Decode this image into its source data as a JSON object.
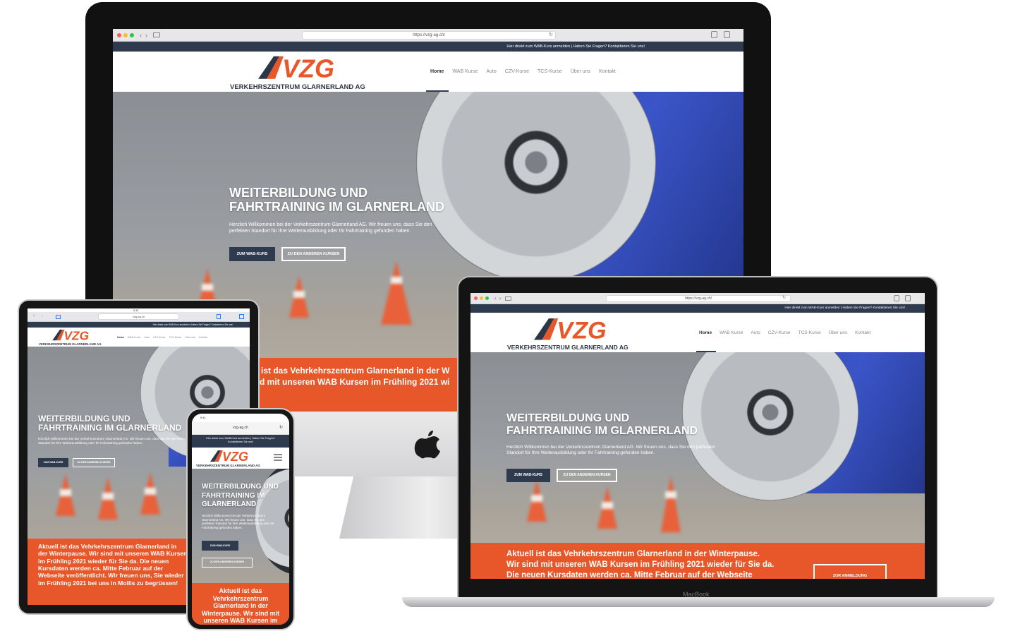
{
  "site": {
    "url": "https://vzg-ag.ch/",
    "url_short": "vzg-ag.ch",
    "topbar": "Hier direkt zum WAB-Kurs anmelden | Haben Sie Fragen? Kontaktieren Sie uns!",
    "logo_mark": "VZG",
    "logo_tagline": "VERKEHRSZENTRUM GLARNERLAND AG",
    "nav": [
      "Home",
      "WAB Kurse",
      "Auto",
      "CZV-Kurse",
      "TCS-Kurse",
      "Über uns",
      "Kontakt"
    ],
    "hero_title_line1": "WEITERBILDUNG UND",
    "hero_title_line2": "FAHRTRAINING IM GLARNERLAND",
    "hero_text": "Herzlich Willkommen bei der Verkehrszentrum Glarnerland AG. Wir freuen uns, dass Sie den perfekten Standort für Ihre Weiterausbildung oder Ihr Fahrtraining gefunden haben.",
    "btn_primary": "ZUM WAB-KURS",
    "btn_secondary": "ZU DEN ANDEREN KURSEN",
    "btn_register": "ZUR ANMELDUNG",
    "notice": "Aktuell ist das Vehrkehrszentrum Glarnerland in der Winterpause. Wir sind mit unseren WAB Kursen im Frühling 2021 wieder für Sie da. Die neuen Kursdaten werden ca. Mitte Februar auf der Webseite veröffentlicht. Wir freuen uns, Sie wieder im Frühling 2021 bei uns in Mollis zu begrüssen!",
    "imac_notice_line1": "ist das Vehrkehrszentrum Glarnerland in der W",
    "imac_notice_line2": "d mit unseren WAB Kursen im Frühling 2021 wi",
    "laptop_notice_line1": "Aktuell ist das Vehrkehrszentrum Glarnerland in der Winterpause.",
    "laptop_notice_line2": "Wir sind mit unseren WAB Kursen im Frühling 2021 wieder für Sie da.",
    "laptop_notice_line3": "Die neuen Kursdaten werden ca. Mitte Februar auf der Webseite",
    "phone_notice": "Aktuell ist das Vehrkehrszentrum Glarnerland in der Winterpause. Wir sind mit unseren WAB Kursen im",
    "phone_title": "WEITERBILDUNG UND FAHRTRAINING IM GLARNERLAND",
    "phone_topbar": "Hier direkt zum WAB-Kurs anmelden | Haben Sie Fragen? Kontaktieren Sie uns!",
    "laptop_label": "MacBook",
    "status_time": "9:41"
  },
  "colors": {
    "navy": "#2e3b4e",
    "orange": "#e8572a",
    "logo_orange": "#e8572a",
    "car_blue": "#3a55c8"
  },
  "icons": [
    "apple-logo-icon",
    "hamburger-menu-icon",
    "reload-icon",
    "back-icon",
    "forward-icon",
    "sidebar-icon",
    "share-icon",
    "tabs-icon"
  ]
}
